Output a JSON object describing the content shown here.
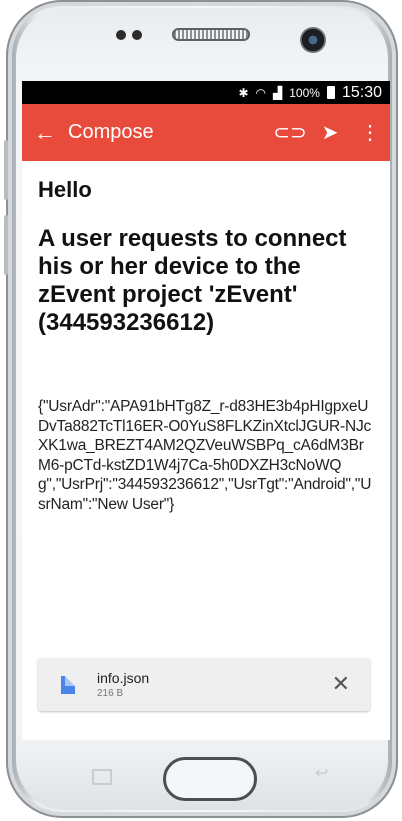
{
  "status_bar": {
    "icons": [
      "bluetooth-icon",
      "wifi-icon",
      "signal-icon"
    ],
    "battery": "100%",
    "time": "15:30"
  },
  "app_bar": {
    "title": "Compose",
    "back_icon": "arrow-left-icon",
    "attach_icon": "paperclip-icon",
    "send_icon": "send-icon",
    "overflow_icon": "more-vert-icon",
    "color": "#e84b3c"
  },
  "email": {
    "greeting": "Hello",
    "headline": "A user requests to connect his or her device to the zEvent project 'zEvent' (344593236612)",
    "payload": "{\"UsrAdr\":\"APA91bHTg8Z_r-d83HE3b4pHIgpxeUDvTa882TcTl16ER-O0YuS8FLKZinXtclJGUR-NJcXK1wa_BREZT4AM2QZVeuWSBPq_cA6dM3BrM6-pCTd-kstZD1W4j7Ca-5h0DXZH3cNoWQg\",\"UsrPrj\":\"344593236612\",\"UsrTgt\":\"Android\",\"UsrNam\":\"New User\"}"
  },
  "attachment": {
    "name": "info.json",
    "size": "216 B",
    "icon": "file-icon"
  },
  "nav_keys": {
    "recent_icon": "recent-apps-icon",
    "home_icon": "home-button",
    "back_icon": "back-key-icon"
  }
}
